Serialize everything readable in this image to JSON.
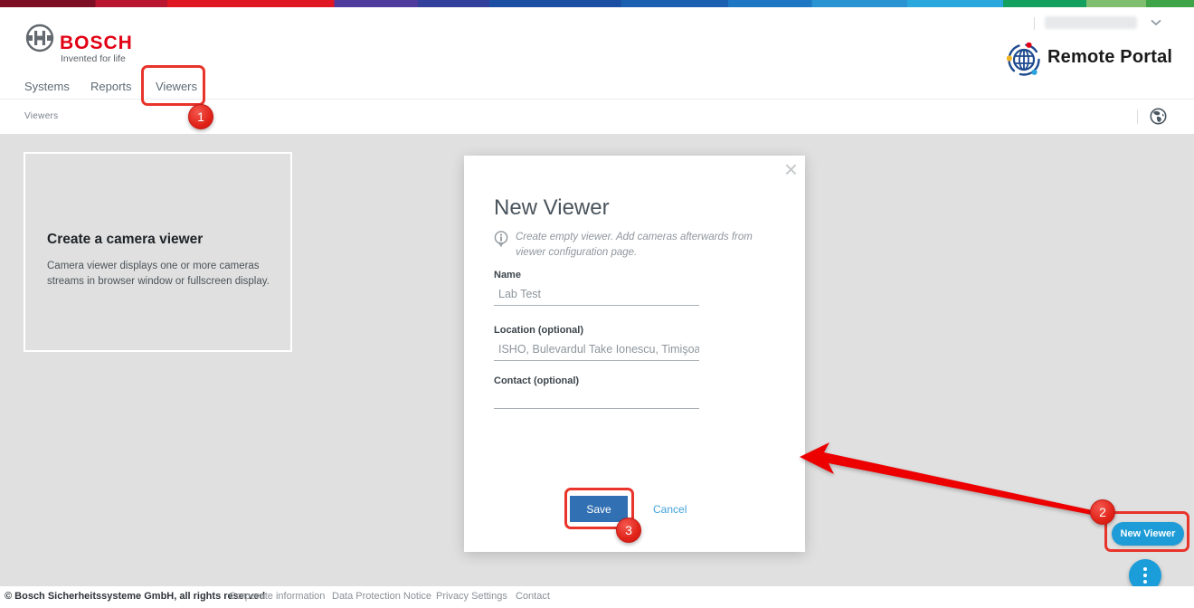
{
  "brand": {
    "wordmark": "BOSCH",
    "tagline": "Invented for life",
    "product_name": "Remote Portal",
    "accent_red": "#e20015"
  },
  "header": {
    "nav_tabs": [
      {
        "label": "Systems",
        "active": false
      },
      {
        "label": "Reports",
        "active": false
      },
      {
        "label": "Viewers",
        "active": true
      }
    ]
  },
  "breadcrumb": {
    "label": "Viewers"
  },
  "card": {
    "title": "Create a camera viewer",
    "body": "Camera viewer displays one or more cameras streams in browser window or fullscreen display."
  },
  "modal": {
    "title": "New Viewer",
    "info_text": "Create empty viewer. Add cameras afterwards from viewer configuration page.",
    "fields": [
      {
        "label": "Name",
        "value": "Lab Test"
      },
      {
        "label": "Location (optional)",
        "value": "ISHO, Bulevardul Take Ionescu, Timişoara, Romar"
      },
      {
        "label": "Contact (optional)",
        "value": ""
      }
    ],
    "save_label": "Save",
    "cancel_label": "Cancel"
  },
  "actions": {
    "new_viewer_label": "New Viewer"
  },
  "annotations": {
    "step1": "1",
    "step2": "2",
    "step3": "3",
    "annotation_red": "#e8342b",
    "arrow_red": "#ec0000"
  },
  "icons": {
    "close": "×",
    "bosch_logo": "bosch-logo",
    "remote_portal_globe": "remote-portal-globe",
    "world_globe": "world-globe",
    "info": "info-circle",
    "chevron_down": "chevron-down",
    "kebab_menu": "three-dots"
  },
  "colors": {
    "save_button_blue": "#3170b2",
    "link_blue": "#41a1d9",
    "pill_button_blue": "#1e9cd8",
    "main_background": "#e0e0e0"
  },
  "footer": {
    "copyright": "© Bosch Sicherheitssysteme GmbH, all rights reserved",
    "links": [
      "Corporate information",
      "Data Protection Notice",
      "Privacy Settings",
      "Contact"
    ]
  }
}
